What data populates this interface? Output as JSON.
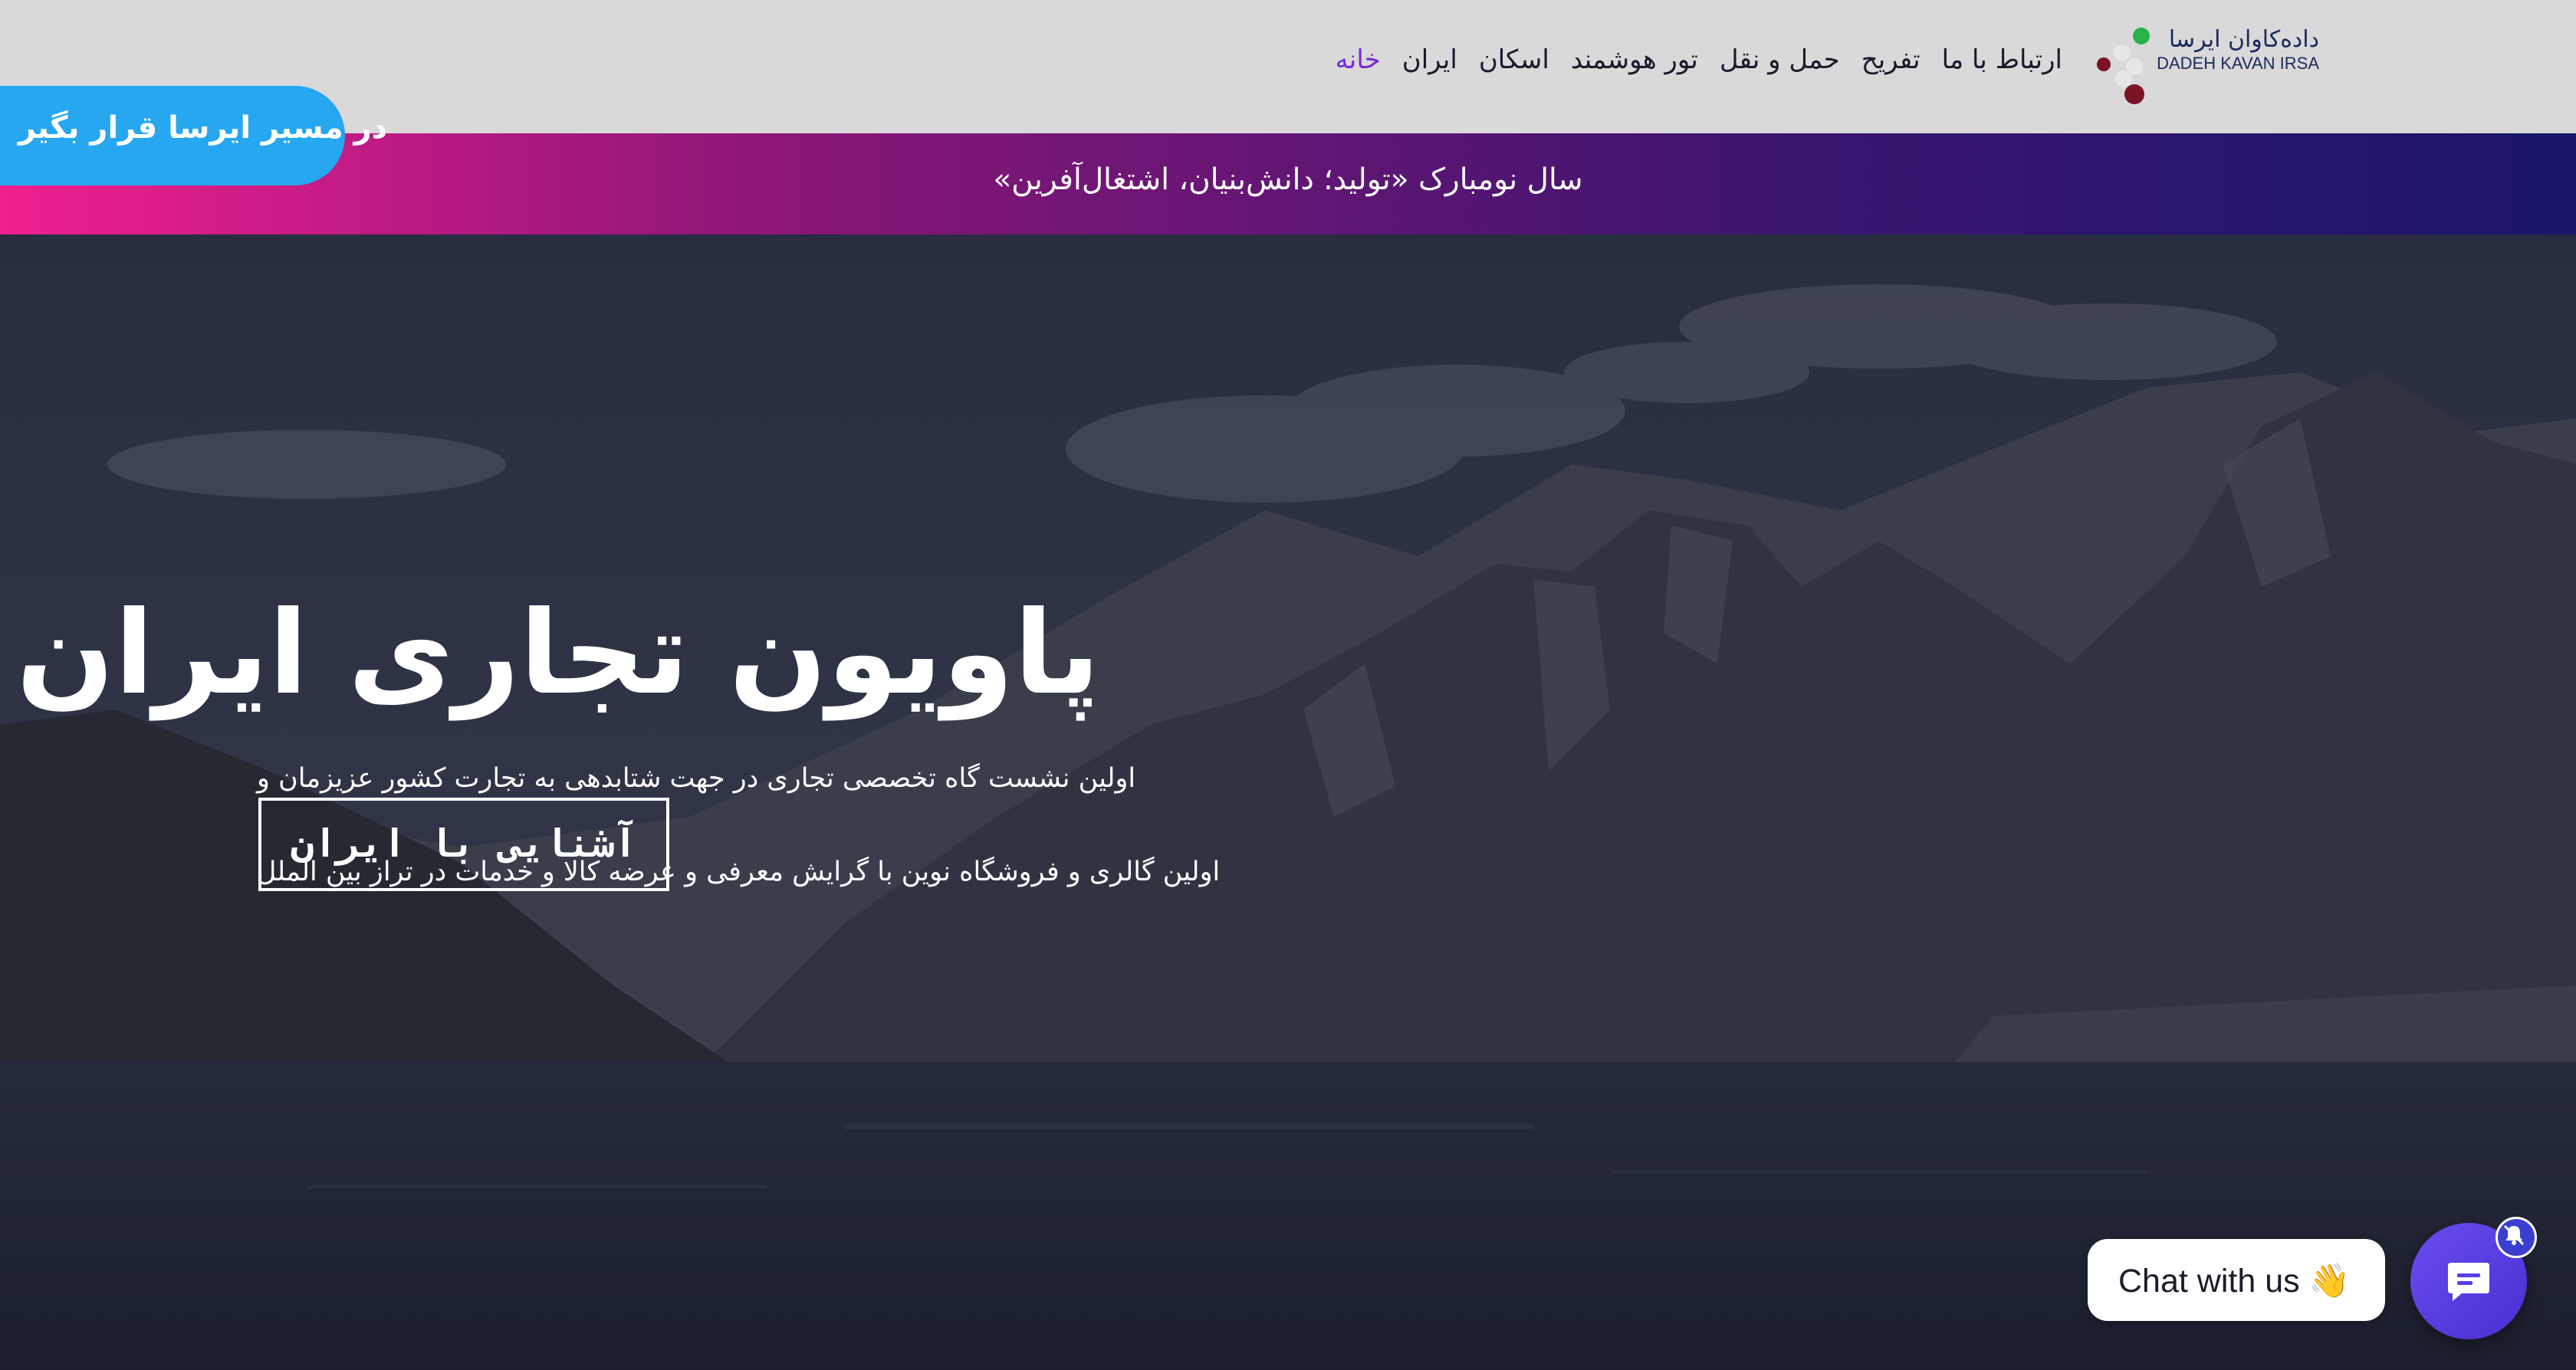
{
  "header": {
    "logo": {
      "name": "داده‌کاوان ایرسا",
      "subtitle": "DADEH KAVAN IRSA"
    },
    "nav": [
      {
        "label": "خانه",
        "active": true
      },
      {
        "label": "ایران",
        "active": false
      },
      {
        "label": "اسکان",
        "active": false
      },
      {
        "label": "تور هوشمند",
        "active": false
      },
      {
        "label": "حمل و نقل",
        "active": false
      },
      {
        "label": "تفریح",
        "active": false
      },
      {
        "label": "ارتباط با ما",
        "active": false
      }
    ]
  },
  "banner": {
    "text": "سال نومبارک  «تولید؛ دانش‌بنیان، اشتغال‌آفرین»",
    "cta": "در مسیر ایرسا قرار بگیر"
  },
  "hero": {
    "title": "پاویون تجاری ایران",
    "line1": "اولین نشست گاه تخصصی تجاری در جهت شتابدهی به تجارت کشور عزیزمان و",
    "line2": "اولین گالری و فروشگاه نوین با گرایش معرفی و عرضه کالا و خدمات در تراز بین الملل",
    "button": "آشنایی با ایران"
  },
  "chat": {
    "bubble_text": "Chat with us 👋",
    "launcher_icon": "chat-message-icon",
    "badge_icon": "bell-off-icon"
  },
  "colors": {
    "header_bg": "#d9d9d9",
    "nav_active": "#7a28d8",
    "cta_blue": "#26a7f0",
    "banner_start": "#ef1f8f",
    "banner_end": "#1a166a",
    "chat_purple": "#5a3ee6"
  }
}
